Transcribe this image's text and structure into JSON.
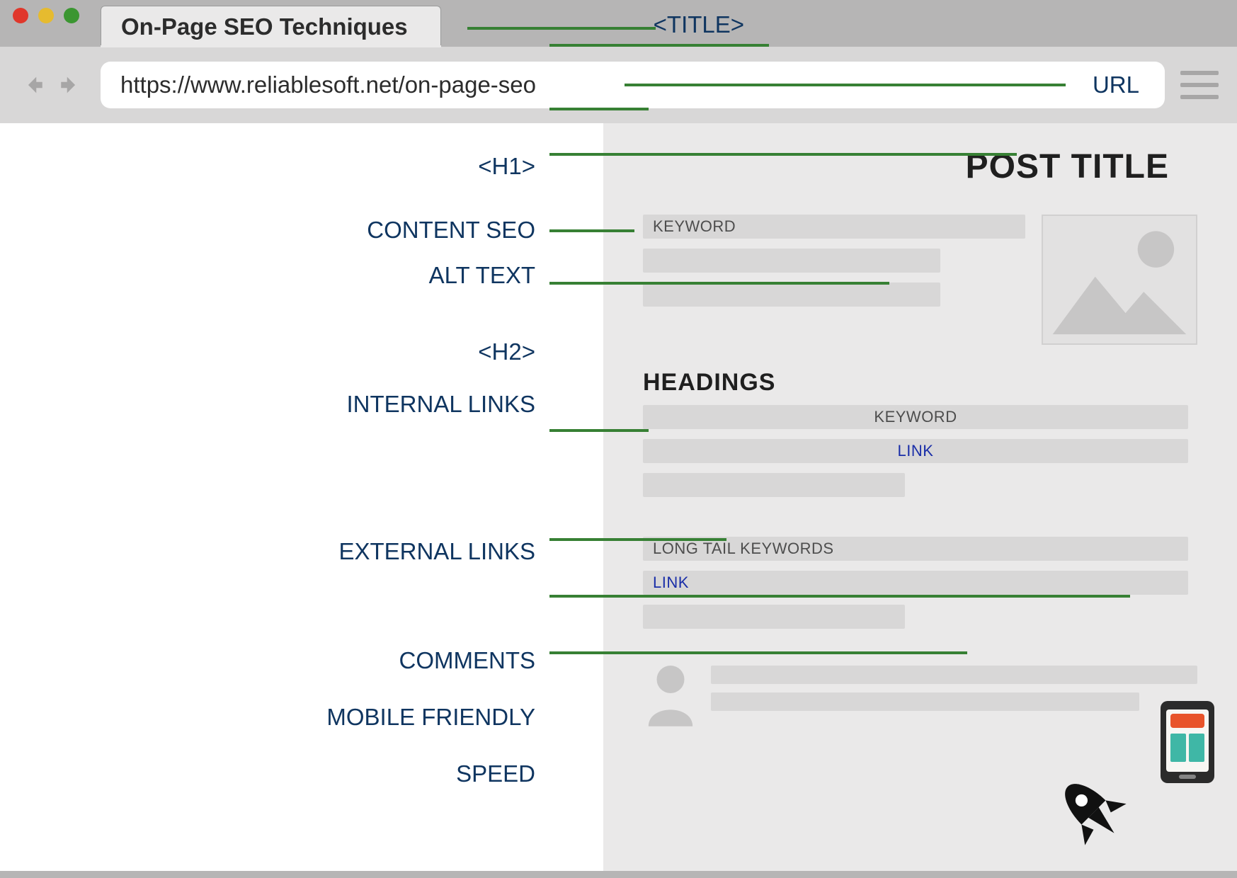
{
  "browser": {
    "tab_title": "On-Page SEO Techniques",
    "title_annotation": "<TITLE>",
    "url": "https://www.reliablesoft.net/on-page-seo",
    "url_annotation": "URL"
  },
  "labels": {
    "h1": "<H1>",
    "content_seo": "CONTENT SEO",
    "alt_text": "ALT TEXT",
    "h2": "<H2>",
    "internal_links": "INTERNAL LINKS",
    "external_links": "EXTERNAL LINKS",
    "comments": "COMMENTS",
    "mobile_friendly": "MOBILE FRIENDLY",
    "speed": "SPEED"
  },
  "page": {
    "post_title": "POST TITLE",
    "headings": "HEADINGS",
    "keyword": "KEYWORD",
    "keyword2": "KEYWORD",
    "long_tail": "LONG TAIL KEYWORDS",
    "link": "LINK",
    "link2": "LINK"
  },
  "colors": {
    "label": "#0f3560",
    "connector": "#378034",
    "bar": "#d8d7d7",
    "page_bg": "#eae9e9"
  }
}
